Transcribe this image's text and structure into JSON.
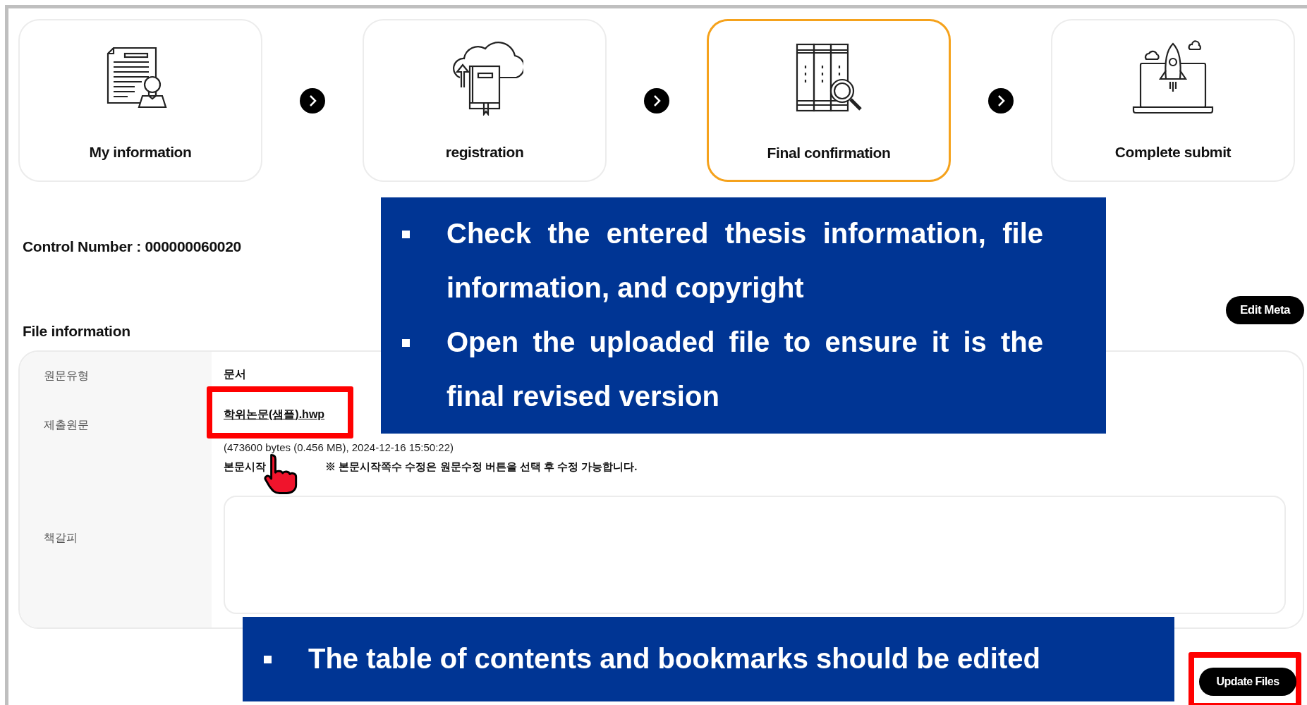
{
  "steps": [
    {
      "label": "My information",
      "selected": false
    },
    {
      "label": "registration",
      "selected": false
    },
    {
      "label": "Final confirmation",
      "selected": true
    },
    {
      "label": "Complete submit",
      "selected": false
    }
  ],
  "control_number": "Control Number : 000000060020",
  "edit_meta_button": "Edit Meta",
  "file_information": {
    "title": "File information",
    "rows": [
      {
        "kind": "text",
        "label": "원문유형",
        "value": "문서"
      },
      {
        "kind": "file",
        "label": "제출원문",
        "link": "학위논문(샘플).hwp",
        "details": "(473600 bytes (0.456 MB), 2024-12-16 15:50:22)",
        "start_page_label": "본문시작",
        "note": "※ 본문시작쪽수 수정은 원문수정 버튼을 선택 후 수정 가능합니다."
      },
      {
        "kind": "textarea",
        "label": "책갈피"
      }
    ]
  },
  "update_files_button": "Update Files",
  "callouts": [
    {
      "bullets": [
        "Check the entered thesis information, file information, and copyright",
        "Open the uploaded file to ensure it is the final revised version"
      ]
    },
    {
      "bullets": [
        "The table of contents and bookmarks should be edited"
      ]
    }
  ]
}
